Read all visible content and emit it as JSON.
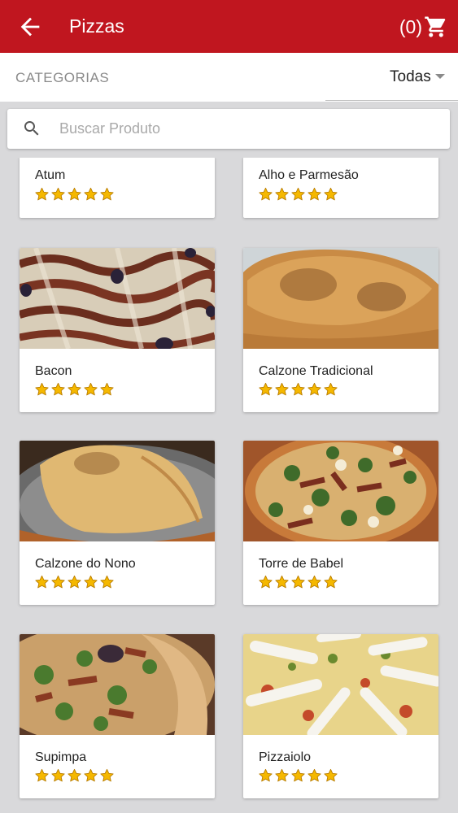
{
  "appbar": {
    "title": "Pizzas",
    "cart_count": "(0)"
  },
  "categories": {
    "label": "CATEGORIAS",
    "selected": "Todas"
  },
  "search": {
    "placeholder": "Buscar Produto"
  },
  "products": [
    {
      "name": "Atum",
      "rating": 5
    },
    {
      "name": "Alho e Parmesão",
      "rating": 5
    },
    {
      "name": "Bacon",
      "rating": 5
    },
    {
      "name": "Calzone Tradicional",
      "rating": 5
    },
    {
      "name": "Calzone do Nono",
      "rating": 5
    },
    {
      "name": "Torre de Babel",
      "rating": 5
    },
    {
      "name": "Supimpa",
      "rating": 5
    },
    {
      "name": "Pizzaiolo",
      "rating": 5
    }
  ],
  "colors": {
    "primary": "#c0161f",
    "background": "#d9d9db",
    "star": "#f5b800"
  }
}
